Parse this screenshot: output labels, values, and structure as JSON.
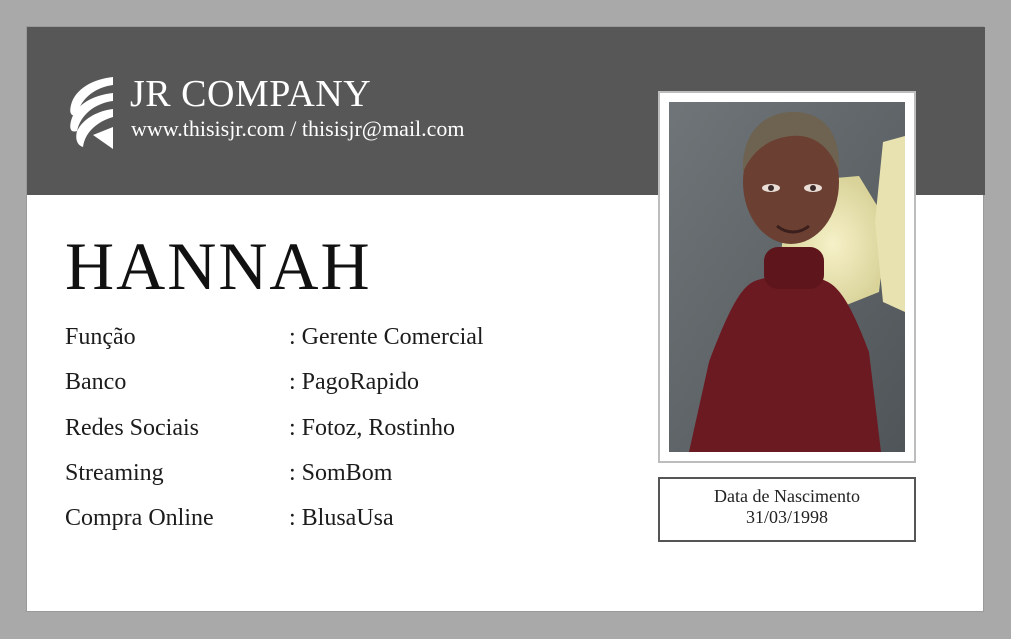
{
  "company": {
    "name": "JR COMPANY",
    "contact": "www.thisisjr.com / thisisjr@mail.com",
    "logo": "company-logo-icon"
  },
  "person": {
    "name": "HANNAH"
  },
  "fields": [
    {
      "label": "Função",
      "value": ": Gerente Comercial"
    },
    {
      "label": "Banco",
      "value": ": PagoRapido"
    },
    {
      "label": "Redes Sociais",
      "value": ": Fotoz, Rostinho"
    },
    {
      "label": "Streaming",
      "value": ": SomBom"
    },
    {
      "label": "Compra Online",
      "value": ": BlusaUsa"
    }
  ],
  "birth": {
    "label": "Data de Nascimento",
    "date": "31/03/1998"
  },
  "colors": {
    "header": "#575757",
    "border": "#a9a9a9",
    "text": "#1c1c1c"
  }
}
